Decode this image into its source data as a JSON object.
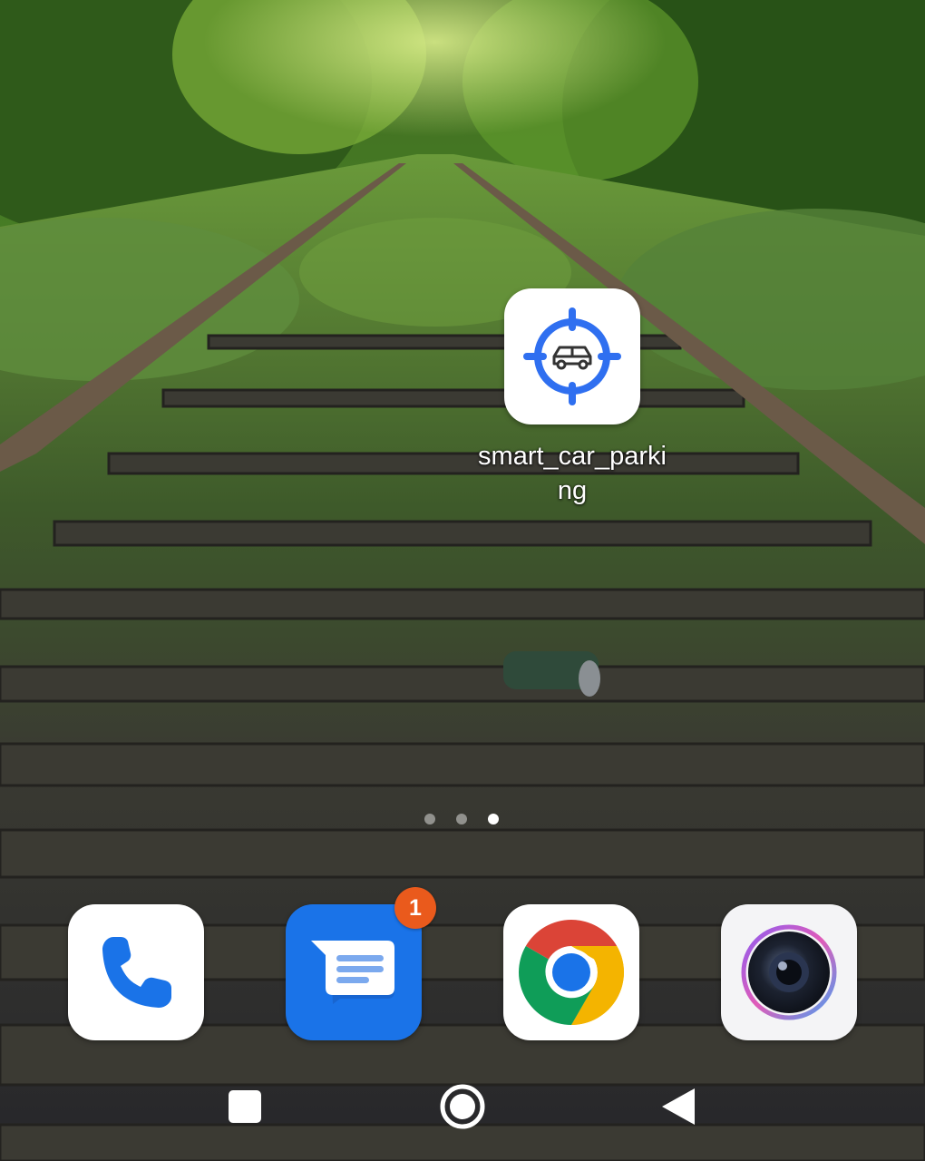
{
  "home": {
    "app_shortcut": {
      "label": "smart_car_parking",
      "icon": "car-target-icon",
      "accent": "#2f6ff0"
    },
    "page_indicator": {
      "pages": 3,
      "current_page": 3
    }
  },
  "dock": {
    "apps": [
      {
        "name": "Phone",
        "icon": "phone-icon"
      },
      {
        "name": "Messages",
        "icon": "messages-icon",
        "badge": "1"
      },
      {
        "name": "Chrome",
        "icon": "chrome-icon"
      },
      {
        "name": "Camera",
        "icon": "camera-icon"
      }
    ]
  },
  "nav_bar": {
    "recents": "recents-square-icon",
    "home": "home-circle-icon",
    "back": "back-triangle-icon"
  },
  "colors": {
    "badge": "#ea5a1c",
    "messages_blue": "#1a73e8",
    "phone_blue": "#1a73e8",
    "chrome_red": "#db4437",
    "chrome_yellow": "#f4b400",
    "chrome_green": "#0f9d58"
  }
}
